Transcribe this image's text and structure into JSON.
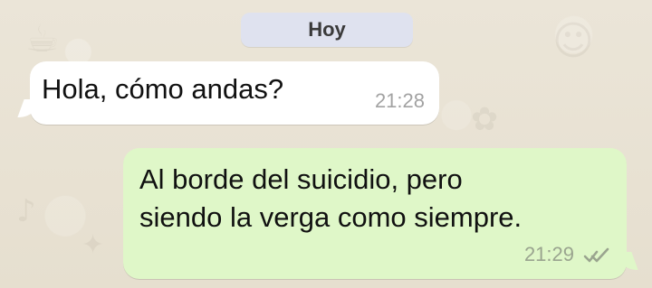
{
  "chat": {
    "date_label": "Hoy",
    "messages": [
      {
        "text": "Hola, cómo andas?",
        "time": "21:28"
      },
      {
        "text": "Al borde del suicidio, pero\nsiendo la verga como siempre.",
        "time": "21:29",
        "status_icon": "double-check-icon"
      }
    ]
  },
  "colors": {
    "background": "#e9e2d3",
    "incoming_bubble": "#ffffff",
    "outgoing_bubble": "#dff7c8",
    "date_pill": "#dfe2ef"
  }
}
